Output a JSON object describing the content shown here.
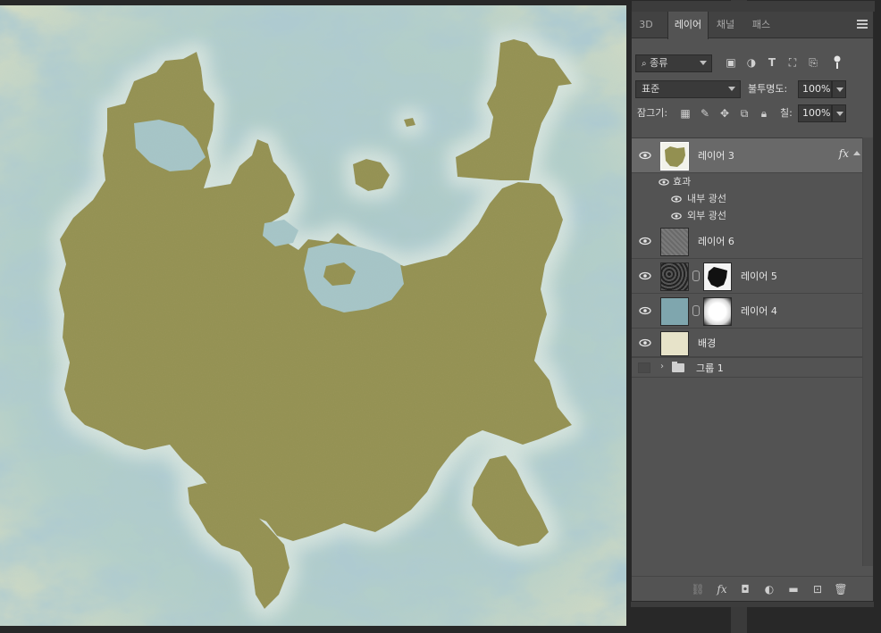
{
  "panel": {
    "tabs": [
      {
        "label": "3D"
      },
      {
        "label": "레이어"
      },
      {
        "label": "채널"
      },
      {
        "label": "패스"
      }
    ],
    "filter": {
      "kind_label": "종류"
    },
    "blend": {
      "mode": "표준",
      "opacity_label": "불투명도:",
      "opacity_value": "100%"
    },
    "lock": {
      "label": "잠그기:",
      "fill_label": "칠:",
      "fill_value": "100%"
    },
    "layers": [
      {
        "name": "레이어 3",
        "selected": true,
        "fx": "fx"
      },
      {
        "name": "레이어 6"
      },
      {
        "name": "레이어 5"
      },
      {
        "name": "레이어 4"
      },
      {
        "name": "배경"
      }
    ],
    "effects": {
      "header": "효과",
      "items": [
        "내부 광선",
        "외부 광선"
      ]
    },
    "group": {
      "name": "그룹 1"
    },
    "bottom_fx": "fx"
  },
  "colors": {
    "land": "#939051",
    "water_light": "#a9c8cc",
    "water_dark": "#6f9eab",
    "panel_bg": "#535353",
    "selected_row": "#696969",
    "background_swatch": "#e7e3c9",
    "layer4_swatch": "#7fa6ae"
  },
  "icons": {
    "visibility": "eye-icon",
    "search": "search-icon",
    "menu": "panel-menu-icon",
    "folder": "folder-icon",
    "link": "chain-link-icon",
    "trash": "trash-icon"
  }
}
